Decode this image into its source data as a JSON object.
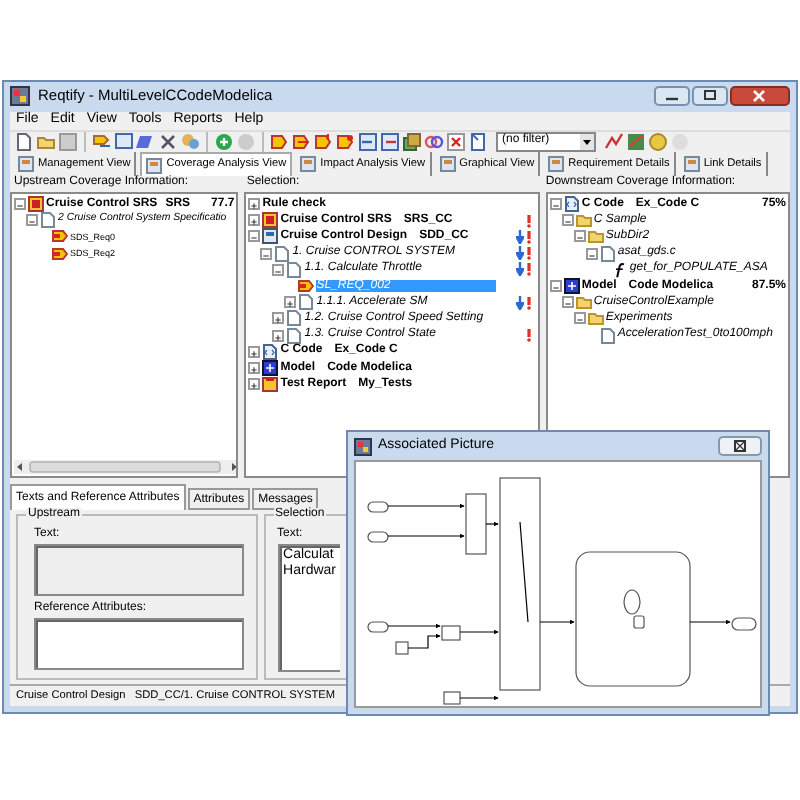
{
  "window": {
    "title": "Reqtify - MultiLevelCCodeModelica"
  },
  "menu": [
    "File",
    "Edit",
    "View",
    "Tools",
    "Reports",
    "Help"
  ],
  "toolbar": {
    "filter": "(no filter)"
  },
  "view_tabs": [
    {
      "label": "Management View",
      "selected": false
    },
    {
      "label": "Coverage Analysis View",
      "selected": true
    },
    {
      "label": "Impact Analysis View",
      "selected": false
    },
    {
      "label": "Graphical View",
      "selected": false
    },
    {
      "label": "Requirement Details",
      "selected": false
    },
    {
      "label": "Link Details",
      "selected": false
    }
  ],
  "upstream": {
    "label": "Upstream Coverage Information:",
    "tree": [
      {
        "kind": "project",
        "label": "Cruise Control SRS",
        "ref": "SRS",
        "coverage": "77.7",
        "expanded": true,
        "children": [
          {
            "kind": "doc",
            "label": "2 Cruise Control System Specificatio",
            "expanded": true,
            "children": [
              {
                "kind": "req",
                "label": "SDS_Req0"
              },
              {
                "kind": "req",
                "label": "SDS_Req2"
              }
            ]
          }
        ]
      }
    ]
  },
  "selection": {
    "label": "Selection:",
    "tree": [
      {
        "kind": "rule",
        "label": "Rule check",
        "expanded": false,
        "selected": false,
        "link_down": false,
        "alert": false
      },
      {
        "kind": "project",
        "label": "Cruise Control SRS",
        "ref": "SRS_CC",
        "expanded": false,
        "selected": false,
        "link_down": false,
        "alert": true
      },
      {
        "kind": "design",
        "label": "Cruise Control Design",
        "ref": "SDD_CC",
        "expanded": true,
        "selected": false,
        "link_down": true,
        "alert": true,
        "children": [
          {
            "kind": "doc",
            "label": "1. Cruise CONTROL SYSTEM",
            "expanded": true,
            "selected": false,
            "link_down": true,
            "alert": true,
            "children": [
              {
                "kind": "doc",
                "label": "1.1. Calculate Throttle",
                "expanded": true,
                "selected": false,
                "link_down": true,
                "alert": true,
                "children": [
                  {
                    "kind": "req",
                    "label": "SL_REQ_002",
                    "selected": true,
                    "link_down": false,
                    "alert": false
                  },
                  {
                    "kind": "doc",
                    "label": "1.1.1. Accelerate SM",
                    "expanded": false,
                    "selected": false,
                    "link_down": true,
                    "alert": true
                  }
                ]
              },
              {
                "kind": "doc",
                "label": "1.2. Cruise Control Speed Setting",
                "expanded": false,
                "selected": false,
                "link_down": false,
                "alert": false
              },
              {
                "kind": "doc",
                "label": "1.3. Cruise Control State",
                "expanded": false,
                "selected": false,
                "link_down": false,
                "alert": true
              }
            ]
          }
        ]
      },
      {
        "kind": "code",
        "label": "C Code",
        "ref": "Ex_Code C",
        "expanded": false,
        "selected": false,
        "link_down": false,
        "alert": false
      },
      {
        "kind": "model",
        "label": "Model",
        "ref": "Code Modelica",
        "expanded": false,
        "selected": false,
        "link_down": false,
        "alert": false
      },
      {
        "kind": "test",
        "label": "Test Report",
        "ref": "My_Tests",
        "expanded": false,
        "selected": false,
        "link_down": false,
        "alert": false
      }
    ]
  },
  "downstream": {
    "label": "Downstream Coverage Information:",
    "tree": [
      {
        "kind": "code",
        "label": "C Code",
        "ref": "Ex_Code C",
        "coverage": "75%",
        "expanded": true,
        "children": [
          {
            "kind": "folder",
            "label": "C Sample",
            "expanded": true,
            "children": [
              {
                "kind": "folder",
                "label": "SubDir2",
                "expanded": true,
                "children": [
                  {
                    "kind": "file",
                    "label": "asat_gds.c",
                    "expanded": true,
                    "children": [
                      {
                        "kind": "function",
                        "label": "get_for_POPULATE_ASA"
                      }
                    ]
                  }
                ]
              }
            ]
          }
        ]
      },
      {
        "kind": "model",
        "label": "Model",
        "ref": "Code Modelica",
        "coverage": "87.5%",
        "expanded": true,
        "children": [
          {
            "kind": "folder",
            "label": "CruiseControlExample",
            "expanded": true,
            "children": [
              {
                "kind": "folder",
                "label": "Experiments",
                "expanded": true,
                "children": [
                  {
                    "kind": "file",
                    "label": "AccelerationTest_0to100mph"
                  }
                ]
              }
            ]
          }
        ]
      }
    ]
  },
  "detail_tabs": [
    {
      "label": "Texts and Reference Attributes",
      "selected": true
    },
    {
      "label": "Attributes",
      "selected": false
    },
    {
      "label": "Messages",
      "selected": false
    }
  ],
  "upstream_group": {
    "title": "Upstream",
    "text_label": "Text:",
    "reference_label": "Reference Attributes:"
  },
  "selection_group": {
    "title": "Selection",
    "text_label": "Text:",
    "text_lines": [
      "Calculat",
      "Hardwar"
    ]
  },
  "status_bar": "Cruise Control Design   SDD_CC/1. Cruise CONTROL SYSTEM",
  "picture_window": {
    "title": "Associated Picture"
  }
}
